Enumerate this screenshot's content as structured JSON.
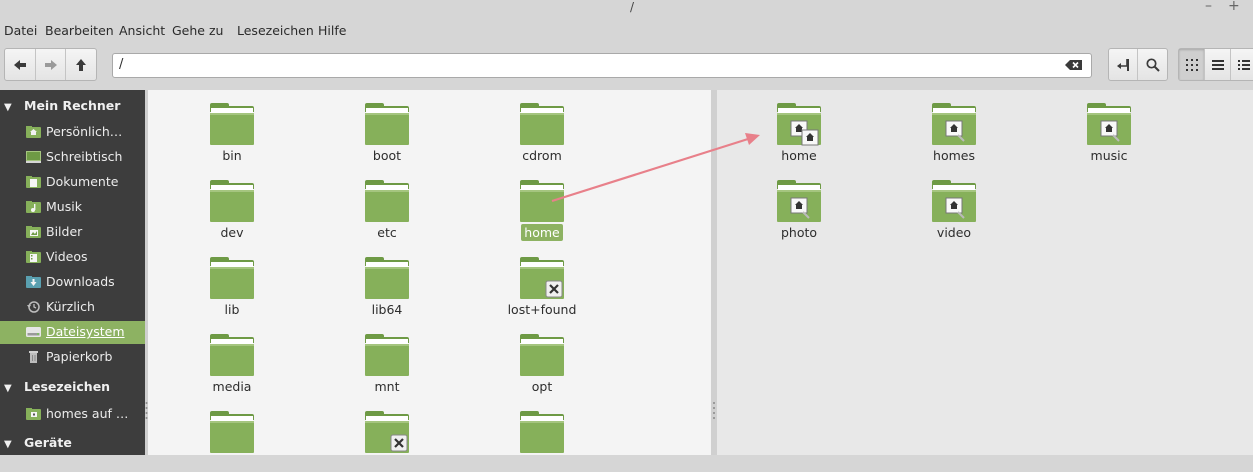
{
  "window": {
    "title": "/",
    "minimize_glyph": "–",
    "maximize_glyph": "+"
  },
  "menu": [
    "Datei",
    "Bearbeiten",
    "Ansicht",
    "Gehe zu",
    "Lesezeichen",
    "Hilfe"
  ],
  "location": {
    "path": "/"
  },
  "sidebar": {
    "sections": [
      {
        "label": "Mein Rechner"
      },
      {
        "label": "Lesezeichen"
      },
      {
        "label": "Geräte"
      }
    ],
    "items": [
      {
        "label": "Persönlich…",
        "icon": "home-folder-icon"
      },
      {
        "label": "Schreibtisch",
        "icon": "desktop-icon"
      },
      {
        "label": "Dokumente",
        "icon": "documents-folder-icon"
      },
      {
        "label": "Musik",
        "icon": "music-folder-icon"
      },
      {
        "label": "Bilder",
        "icon": "pictures-folder-icon"
      },
      {
        "label": "Videos",
        "icon": "videos-folder-icon"
      },
      {
        "label": "Downloads",
        "icon": "downloads-folder-icon"
      },
      {
        "label": "Kürzlich",
        "icon": "recent-icon"
      },
      {
        "label": "Dateisystem",
        "icon": "filesystem-icon",
        "selected": true
      },
      {
        "label": "Papierkorb",
        "icon": "trash-icon"
      }
    ],
    "bookmarks": [
      {
        "label": "homes auf …",
        "icon": "network-folder-icon"
      }
    ]
  },
  "left_pane": {
    "items": [
      {
        "name": "bin"
      },
      {
        "name": "boot"
      },
      {
        "name": "cdrom"
      },
      {
        "name": "dev"
      },
      {
        "name": "etc"
      },
      {
        "name": "home",
        "selected": true
      },
      {
        "name": "lib"
      },
      {
        "name": "lib64"
      },
      {
        "name": "lost+found",
        "badge": "locked"
      },
      {
        "name": "media"
      },
      {
        "name": "mnt"
      },
      {
        "name": "opt"
      },
      {
        "name": ""
      },
      {
        "name": "",
        "badge": "locked"
      },
      {
        "name": ""
      }
    ]
  },
  "right_pane": {
    "items": [
      {
        "name": "home",
        "badge": "shared-home"
      },
      {
        "name": "homes",
        "badge": "share"
      },
      {
        "name": "music",
        "badge": "share"
      },
      {
        "name": "photo",
        "badge": "share"
      },
      {
        "name": "video",
        "badge": "share"
      }
    ]
  },
  "colors": {
    "folder_green": "#86b05a",
    "folder_green_dark": "#6e9a45",
    "selection": "#8db262",
    "sidebar_bg": "#3d3d3d",
    "annotation_arrow": "#e8808a"
  }
}
